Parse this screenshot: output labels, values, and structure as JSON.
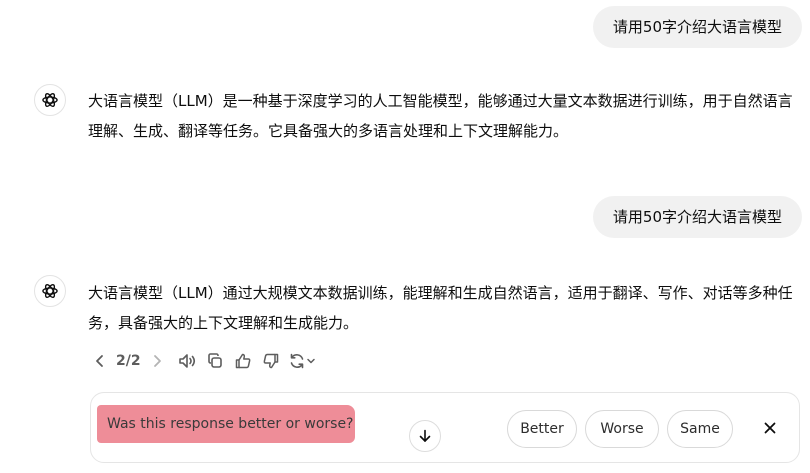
{
  "conversation": {
    "turns": [
      {
        "user": "请用50字介绍大语言模型",
        "assistant": "大语言模型（LLM）是一种基于深度学习的人工智能模型，能够通过大量文本数据进行训练，用于自然语言理解、生成、翻译等任务。它具备强大的多语言处理和上下文理解能力。"
      },
      {
        "user": "请用50字介绍大语言模型",
        "assistant": "大语言模型（LLM）通过大规模文本数据训练，能理解和生成自然语言，适用于翻译、写作、对话等多种任务，具备强大的上下文理解和生成能力。"
      }
    ]
  },
  "actions": {
    "counter": "2/2",
    "icons": [
      "chevron-left-icon",
      "chevron-right-icon",
      "read-aloud-icon",
      "copy-icon",
      "thumbs-up-icon",
      "thumbs-down-icon",
      "regenerate-icon",
      "chevron-down-icon"
    ]
  },
  "feedback": {
    "question": "Was this response better or worse?",
    "options": [
      "Better",
      "Worse",
      "Same"
    ],
    "highlight_color": "#ee8d98"
  }
}
